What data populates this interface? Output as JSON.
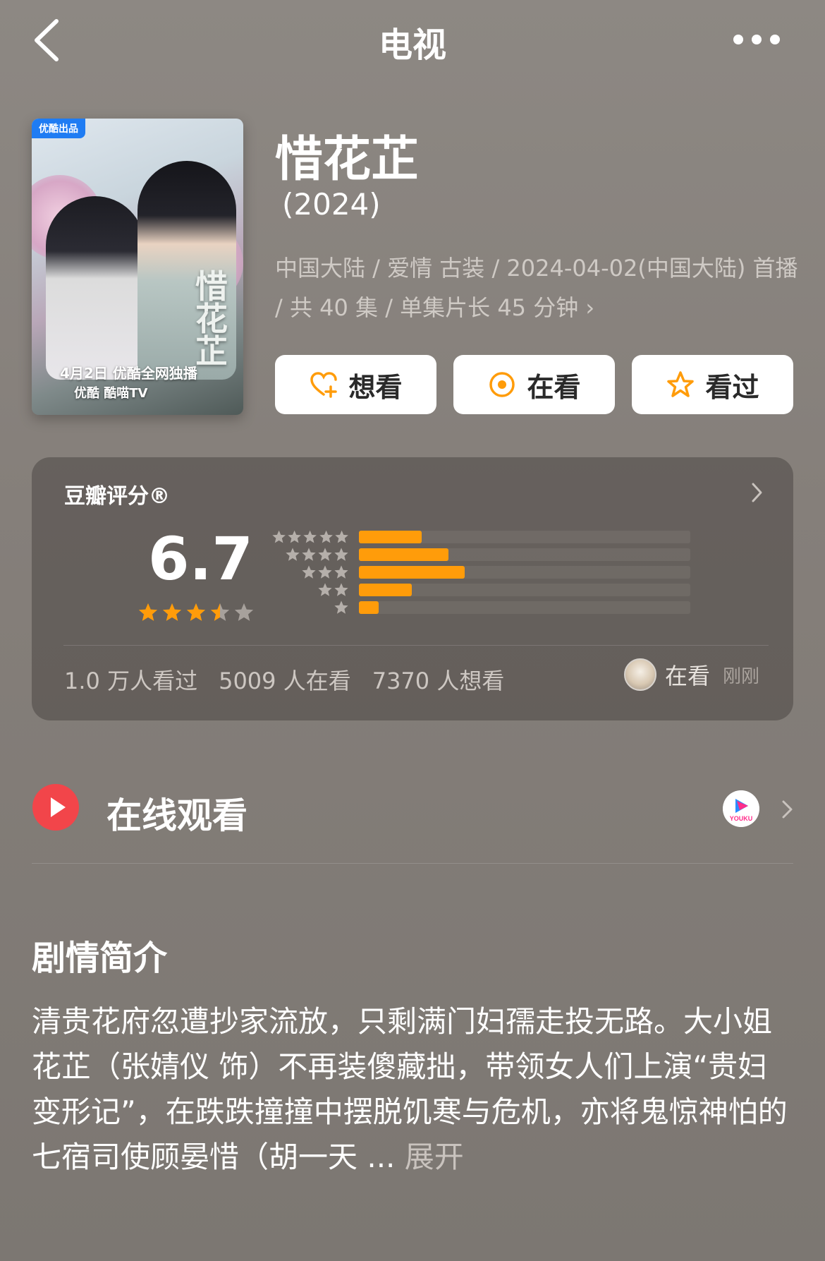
{
  "nav": {
    "title": "电视"
  },
  "poster": {
    "badge": "优酷出品",
    "calligraphy": "惜花芷",
    "release_line": "4月2日 优酷全网独播",
    "platforms": "优酷  酷喵TV"
  },
  "show": {
    "title": "惜花芷",
    "year": "(2024)",
    "meta": "中国大陆 / 爱情 古装 / 2024-04-02(中国大陆) 首播 / 共 40 集 / 单集片长 45 分钟"
  },
  "actions": [
    {
      "label": "想看",
      "icon": "heart-plus-icon"
    },
    {
      "label": "在看",
      "icon": "target-circle-icon"
    },
    {
      "label": "看过",
      "icon": "star-outline-icon"
    }
  ],
  "rating": {
    "label": "豆瓣评分®",
    "score": "6.7",
    "star_value": 3.5,
    "distribution": [
      {
        "stars": 5,
        "fraction": 0.19
      },
      {
        "stars": 4,
        "fraction": 0.27
      },
      {
        "stars": 3,
        "fraction": 0.32
      },
      {
        "stars": 2,
        "fraction": 0.16
      },
      {
        "stars": 1,
        "fraction": 0.06
      }
    ],
    "counts": {
      "watched": "1.0 万人看过",
      "watching": "5009 人在看",
      "want": "7370 人想看"
    },
    "recent": {
      "status": "在看",
      "time": "刚刚"
    }
  },
  "watch": {
    "label": "在线观看",
    "provider": "YOUKU"
  },
  "synopsis": {
    "title": "剧情简介",
    "text": "清贵花府忽遭抄家流放，只剩满门妇孺走投无路。大小姐花芷（张婧仪 饰）不再装傻藏拙，带领女人们上演“贵妇变形记”，在跌跌撞撞中摆脱饥寒与危机，亦将鬼惊神怕的七宿司使顾晏惜（胡一天 ... ",
    "expand": "展开"
  },
  "colors": {
    "accent": "#ff9c0a",
    "play_red": "#f2454a"
  }
}
